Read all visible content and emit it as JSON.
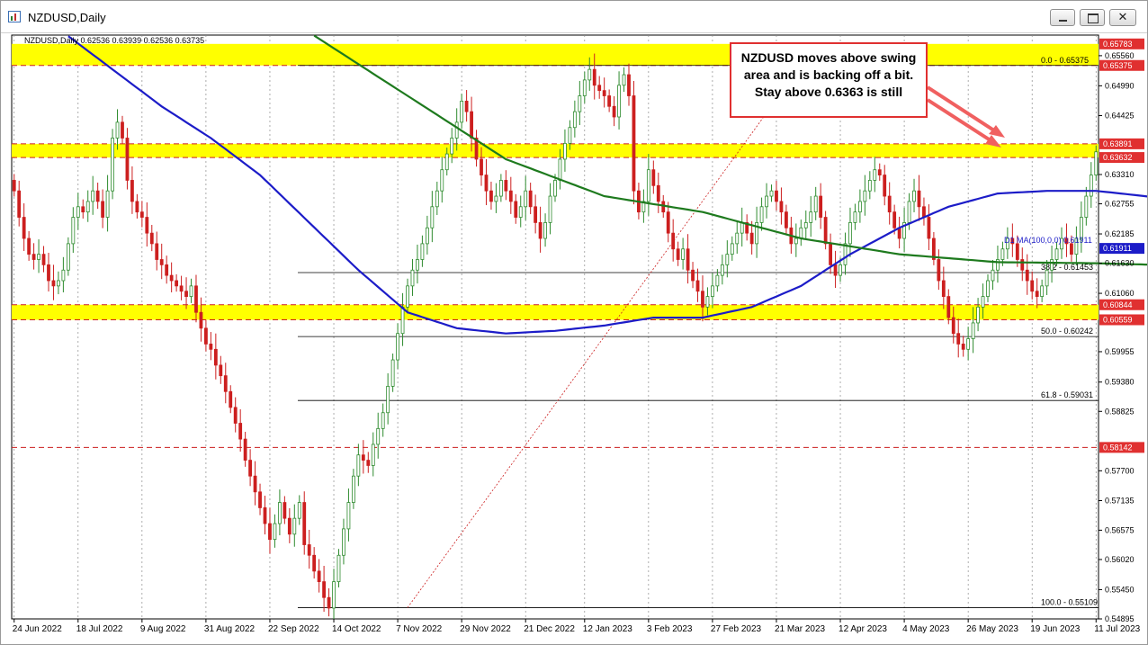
{
  "window": {
    "title": "NZDUSD,Daily"
  },
  "chart_header": "NZDUSD,Daily  0.62536 0.63939 0.62536 0.63735",
  "callout": {
    "text": "NZDUSD moves above swing area and is backing off a bit. Stay above 0.6363 is still"
  },
  "colors": {
    "bull": "#2e8b2e",
    "bear": "#cc1f1f",
    "ma100": "#1c1cc8",
    "ma200": "#1e7a1e",
    "zone": "#ffff00",
    "grid": "#8a8a8a",
    "label_red": "#e03030"
  },
  "chart_data": {
    "type": "candlestick",
    "symbol": "NZDUSD",
    "timeframe": "Daily",
    "ylim": [
      0.54895,
      0.6595
    ],
    "y_ticks": [
      "0.65560",
      "0.64990",
      "0.64425",
      "0.63310",
      "0.62755",
      "0.62185",
      "0.61630",
      "0.61060",
      "0.59955",
      "0.59380",
      "0.58825",
      "0.57700",
      "0.57135",
      "0.56575",
      "0.56020",
      "0.55450",
      "0.54895"
    ],
    "x_labels": [
      "24 Jun 2022",
      "18 Jul 2022",
      "9 Aug 2022",
      "31 Aug 2022",
      "22 Sep 2022",
      "14 Oct 2022",
      "7 Nov 2022",
      "29 Nov 2022",
      "21 Dec 2022",
      "12 Jan 2023",
      "3 Feb 2023",
      "27 Feb 2023",
      "21 Mar 2023",
      "12 Apr 2023",
      "4 May 2023",
      "26 May 2023",
      "19 Jun 2023",
      "11 Jul 2023"
    ],
    "price_labels": [
      {
        "text": "0.65783",
        "value": 0.65783,
        "style": "red"
      },
      {
        "text": "0.65375",
        "value": 0.65375,
        "style": "red"
      },
      {
        "text": "0.63891",
        "value": 0.63891,
        "style": "red"
      },
      {
        "text": "0.63632",
        "value": 0.63632,
        "style": "red"
      },
      {
        "text": "0.61911",
        "value": 0.61911,
        "style": "blue"
      },
      {
        "text": "0.60844",
        "value": 0.60844,
        "style": "red"
      },
      {
        "text": "0.60559",
        "value": 0.60559,
        "style": "red"
      },
      {
        "text": "0.58142",
        "value": 0.58142,
        "style": "red"
      }
    ],
    "zones": [
      {
        "from": 0.65375,
        "to": 0.65783
      },
      {
        "from": 0.63632,
        "to": 0.63891
      },
      {
        "from": 0.60559,
        "to": 0.60844
      }
    ],
    "red_dashed_levels": [
      0.65375,
      0.63891,
      0.63632,
      0.60844,
      0.60559,
      0.58142
    ],
    "fib_levels": [
      {
        "label": "0.0 - 0.65375",
        "value": 0.65375
      },
      {
        "label": "38.2 - 0.61453",
        "value": 0.61453
      },
      {
        "label": "50.0 - 0.60242",
        "value": 0.60242
      },
      {
        "label": "61.8 - 0.59031",
        "value": 0.59031
      },
      {
        "label": "100.0 - 0.55109",
        "value": 0.55109
      }
    ],
    "fib_trendline": {
      "from_index": 80,
      "from": 0.55109,
      "to_index": 160,
      "to": 0.65375
    },
    "ma_label": "D1 MA(100,0,0) 0.61911",
    "series": [
      {
        "name": "D1 MA(100,0,0)",
        "color": "#1c1cc8",
        "points": [
          [
            0,
            0.665
          ],
          [
            10,
            0.66
          ],
          [
            20,
            0.653
          ],
          [
            30,
            0.646
          ],
          [
            40,
            0.64
          ],
          [
            50,
            0.633
          ],
          [
            60,
            0.624
          ],
          [
            70,
            0.615
          ],
          [
            80,
            0.607
          ],
          [
            90,
            0.604
          ],
          [
            100,
            0.603
          ],
          [
            110,
            0.6035
          ],
          [
            120,
            0.6045
          ],
          [
            130,
            0.606
          ],
          [
            140,
            0.606
          ],
          [
            150,
            0.608
          ],
          [
            160,
            0.612
          ],
          [
            170,
            0.618
          ],
          [
            180,
            0.623
          ],
          [
            190,
            0.627
          ],
          [
            200,
            0.6295
          ],
          [
            210,
            0.63
          ],
          [
            220,
            0.63
          ],
          [
            230,
            0.629
          ],
          [
            240,
            0.6275
          ],
          [
            250,
            0.625
          ],
          [
            260,
            0.6225
          ],
          [
            270,
            0.62
          ],
          [
            276,
            0.6191
          ]
        ]
      },
      {
        "name": "MA200",
        "color": "#1e7a1e",
        "points": [
          [
            0,
            0.675
          ],
          [
            20,
            0.672
          ],
          [
            40,
            0.668
          ],
          [
            60,
            0.66
          ],
          [
            80,
            0.648
          ],
          [
            100,
            0.636
          ],
          [
            120,
            0.629
          ],
          [
            140,
            0.626
          ],
          [
            160,
            0.621
          ],
          [
            180,
            0.618
          ],
          [
            200,
            0.6165
          ],
          [
            220,
            0.6163
          ],
          [
            240,
            0.6158
          ],
          [
            260,
            0.6155
          ],
          [
            276,
            0.619
          ]
        ]
      }
    ],
    "closes": [
      0.63,
      0.625,
      0.621,
      0.618,
      0.617,
      0.618,
      0.616,
      0.613,
      0.612,
      0.613,
      0.615,
      0.62,
      0.625,
      0.627,
      0.626,
      0.628,
      0.63,
      0.628,
      0.625,
      0.63,
      0.64,
      0.643,
      0.64,
      0.632,
      0.628,
      0.626,
      0.625,
      0.622,
      0.62,
      0.617,
      0.616,
      0.614,
      0.613,
      0.612,
      0.611,
      0.61,
      0.612,
      0.607,
      0.604,
      0.601,
      0.6,
      0.597,
      0.595,
      0.592,
      0.589,
      0.586,
      0.583,
      0.579,
      0.576,
      0.573,
      0.57,
      0.567,
      0.564,
      0.567,
      0.571,
      0.568,
      0.565,
      0.568,
      0.571,
      0.563,
      0.561,
      0.558,
      0.556,
      0.553,
      0.551,
      0.556,
      0.561,
      0.566,
      0.571,
      0.576,
      0.58,
      0.579,
      0.578,
      0.582,
      0.585,
      0.588,
      0.593,
      0.598,
      0.603,
      0.608,
      0.612,
      0.615,
      0.617,
      0.62,
      0.623,
      0.627,
      0.63,
      0.634,
      0.637,
      0.64,
      0.643,
      0.647,
      0.645,
      0.64,
      0.636,
      0.633,
      0.63,
      0.628,
      0.629,
      0.632,
      0.63,
      0.628,
      0.625,
      0.627,
      0.63,
      0.627,
      0.624,
      0.621,
      0.624,
      0.629,
      0.632,
      0.636,
      0.639,
      0.642,
      0.645,
      0.648,
      0.651,
      0.653,
      0.65,
      0.649,
      0.648,
      0.646,
      0.644,
      0.65,
      0.652,
      0.648,
      0.63,
      0.626,
      0.628,
      0.634,
      0.631,
      0.628,
      0.626,
      0.622,
      0.619,
      0.617,
      0.619,
      0.615,
      0.613,
      0.611,
      0.608,
      0.61,
      0.612,
      0.614,
      0.616,
      0.618,
      0.62,
      0.622,
      0.624,
      0.622,
      0.62,
      0.624,
      0.627,
      0.629,
      0.63,
      0.628,
      0.626,
      0.623,
      0.62,
      0.621,
      0.623,
      0.624,
      0.626,
      0.629,
      0.625,
      0.62,
      0.616,
      0.614,
      0.616,
      0.62,
      0.624,
      0.626,
      0.628,
      0.63,
      0.632,
      0.634,
      0.633,
      0.629,
      0.626,
      0.623,
      0.621,
      0.624,
      0.628,
      0.63,
      0.627,
      0.625,
      0.621,
      0.617,
      0.613,
      0.61,
      0.606,
      0.603,
      0.601,
      0.6,
      0.602,
      0.605,
      0.608,
      0.61,
      0.613,
      0.615,
      0.617,
      0.619,
      0.621,
      0.62,
      0.617,
      0.615,
      0.613,
      0.611,
      0.61,
      0.612,
      0.615,
      0.617,
      0.619,
      0.621,
      0.62,
      0.618,
      0.621,
      0.625,
      0.629,
      0.633,
      0.6374
    ]
  }
}
